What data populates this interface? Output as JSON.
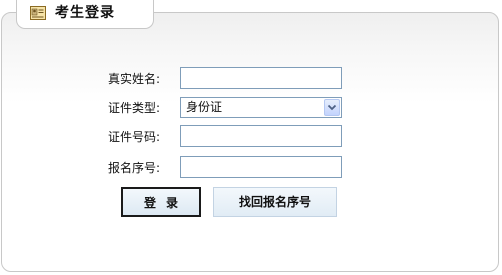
{
  "header": {
    "title": "考生登录",
    "icon": "id-card-icon"
  },
  "form": {
    "name_label": "真实姓名:",
    "name_value": "",
    "doc_type_label": "证件类型:",
    "doc_type_selected": "身份证",
    "doc_number_label": "证件号码:",
    "doc_number_value": "",
    "reg_number_label": "报名序号:",
    "reg_number_value": ""
  },
  "buttons": {
    "login_label": "登录",
    "recover_label": "找回报名序号"
  },
  "colors": {
    "input_border": "#7f9db9",
    "button_bg": "#dde9f3",
    "panel_border": "#c8c8c8"
  }
}
